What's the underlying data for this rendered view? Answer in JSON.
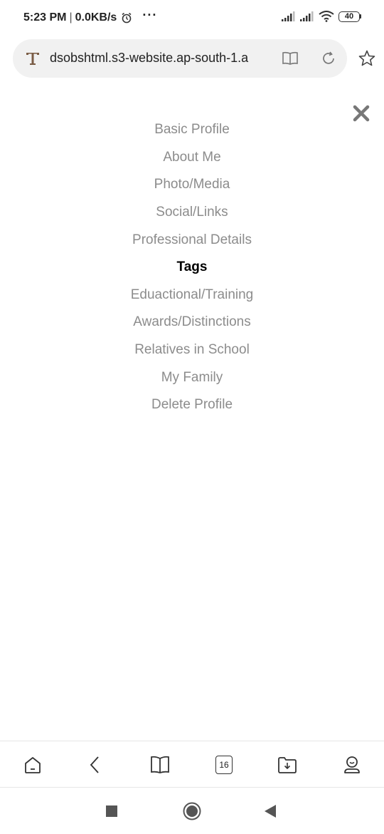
{
  "status_bar": {
    "time": "5:23 PM",
    "separator": "|",
    "net_speed": "0.0KB/s",
    "more": "···",
    "battery": "40"
  },
  "address_bar": {
    "url": "dsobshtml.s3-website.ap-south-1.a"
  },
  "menu": {
    "items": [
      {
        "label": "Basic Profile",
        "active": false
      },
      {
        "label": "About Me",
        "active": false
      },
      {
        "label": "Photo/Media",
        "active": false
      },
      {
        "label": "Social/Links",
        "active": false
      },
      {
        "label": "Professional Details",
        "active": false
      },
      {
        "label": "Tags",
        "active": true
      },
      {
        "label": "Eduactional/Training",
        "active": false
      },
      {
        "label": "Awards/Distinctions",
        "active": false
      },
      {
        "label": "Relatives in School",
        "active": false
      },
      {
        "label": "My Family",
        "active": false
      },
      {
        "label": "Delete Profile",
        "active": false
      }
    ]
  },
  "bottom_toolbar": {
    "tab_count": "16"
  },
  "icons": {
    "close": "close-icon",
    "home": "home-icon",
    "back": "back-icon",
    "bookmarks": "bookmarks-icon",
    "downloads": "download-folder-icon",
    "profile": "profile-icon"
  },
  "colors": {
    "inactive_menu": "#8c8c8c",
    "active_menu": "#000000",
    "address_bg": "#f1f1f1"
  }
}
